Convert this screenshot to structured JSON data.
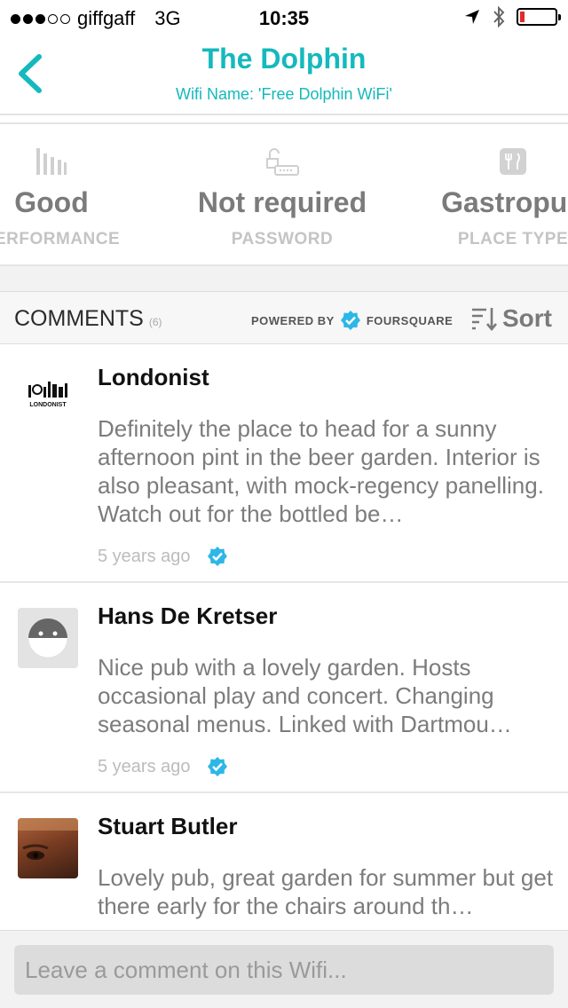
{
  "status_bar": {
    "carrier": "giffgaff",
    "network": "3G",
    "time": "10:35",
    "signal_bars": 3,
    "signal_total": 5
  },
  "nav": {
    "title": "The Dolphin",
    "subtitle": "Wifi Name: 'Free Dolphin WiFi'",
    "back_icon": "chevron-left-icon"
  },
  "stats": [
    {
      "value": "Good",
      "label": "PERFORMANCE",
      "icon": "signal-bars-icon"
    },
    {
      "value": "Not required",
      "label": "PASSWORD",
      "icon": "unlocked-router-icon"
    },
    {
      "value": "Gastropub",
      "label": "PLACE TYPE",
      "icon": "restaurant-icon"
    }
  ],
  "comments_header": {
    "title": "COMMENTS",
    "count": "(6)",
    "powered_by": "POWERED BY",
    "provider": "FOURSQUARE",
    "sort_label": "Sort"
  },
  "comments": [
    {
      "author": "Londonist",
      "text": "Definitely the place to head for a sunny afternoon pint in the beer garden. Interior is also pleasant, with mock-regency panelling. Watch out for the bottled be…",
      "time": "5 years ago",
      "avatar_text": "LONDONIST"
    },
    {
      "author": "Hans De Kretser",
      "text": "Nice pub with a lovely garden. Hosts occasional play and concert. Changing seasonal menus. Linked with Dartmou…",
      "time": "5 years ago"
    },
    {
      "author": "Stuart Butler",
      "text": "Lovely pub, great garden for summer but get there early for the chairs around th…",
      "time": ""
    }
  ],
  "footer": {
    "placeholder": "Leave a comment on this Wifi..."
  },
  "colors": {
    "accent": "#14b9bd",
    "foursquare": "#2db7e6"
  }
}
